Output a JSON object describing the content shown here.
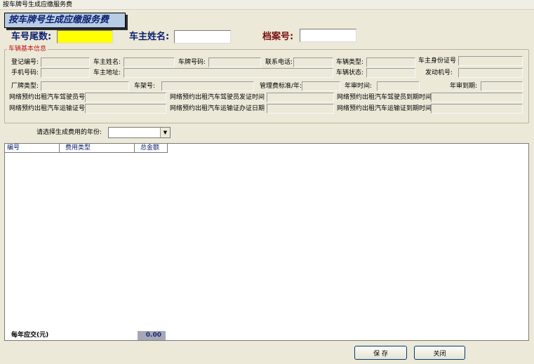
{
  "window": {
    "title": "按车牌号生成应缴服务费"
  },
  "banner": {
    "title": "按车牌号生成应缴服务费"
  },
  "search": {
    "plate_tail_label": "车号尾数:",
    "plate_tail_value": "",
    "owner_name_label": "车主姓名:",
    "owner_name_value": "",
    "file_no_label": "档案号:",
    "file_no_value": ""
  },
  "vehicle_info": {
    "legend": "车辆基本信息",
    "fields": {
      "reg_no": "登记编号:",
      "owner_name": "车主姓名:",
      "plate_no": "车牌号码:",
      "phone": "联系电话:",
      "vehicle_type": "车辆类型:",
      "id_no": "车主身份证号",
      "mobile": "手机号码:",
      "address": "车主地址:",
      "vehicle_status": "车辆状态:",
      "engine_no": "发动机号:",
      "brand_type": "厂牌类型:",
      "frame_no": "车架号:",
      "mgmt_fee": "管理费标准/年:",
      "inspect_time": "年审时间:",
      "inspect_due": "年审到期:",
      "driver_no": "网络预约出租汽车驾驶员号",
      "driver_issue": "网络预约出租汽车驾驶员发证时间",
      "driver_expire": "网络预约出租汽车驾驶员到期时间",
      "transport_no": "网络预约出租汽车运输证号",
      "transport_issue": "网络预约出租汽车运输证办证日期",
      "transport_expire": "网络预约出租汽车运输证到期时间"
    }
  },
  "year_select": {
    "label": "请选择生成费用的年份:",
    "selected": ""
  },
  "grid": {
    "columns": [
      "编号",
      "费用类型",
      "总金额"
    ],
    "rows": []
  },
  "summary": {
    "annual_label": "每年应交(元)",
    "annual_value": "0.00"
  },
  "buttons": {
    "save": "保 存",
    "close": "关闭"
  }
}
